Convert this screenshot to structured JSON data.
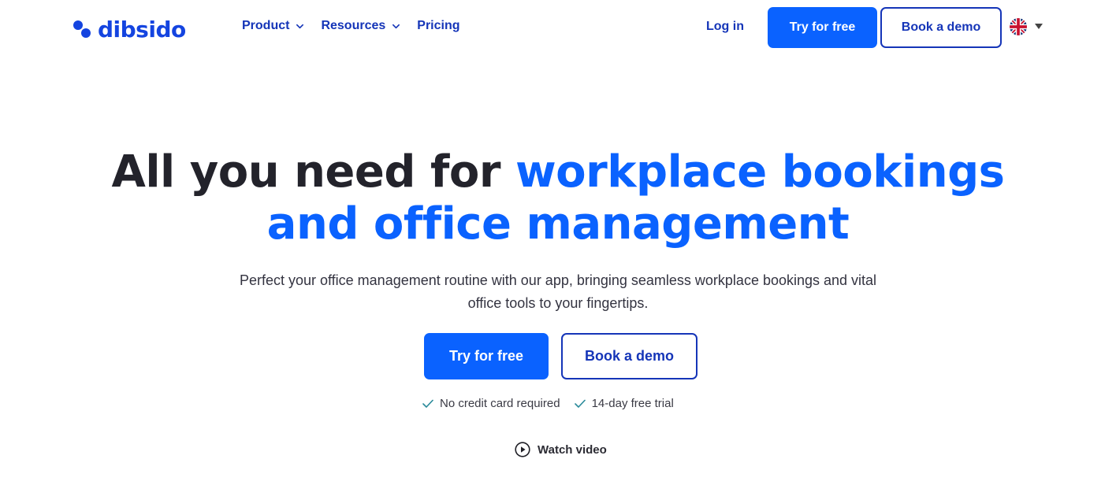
{
  "header": {
    "logo_text": "dibsido",
    "nav": [
      {
        "label": "Product",
        "has_dropdown": true,
        "icon": "chevron-down-icon"
      },
      {
        "label": "Resources",
        "has_dropdown": true,
        "icon": "chevron-down-icon"
      },
      {
        "label": "Pricing",
        "has_dropdown": false
      }
    ],
    "login_label": "Log in",
    "try_label": "Try for free",
    "demo_label": "Book a demo",
    "language_icon": "uk-flag-icon",
    "language_caret_icon": "caret-down-icon"
  },
  "hero": {
    "title_plain": "All you need for ",
    "title_accent_line1": "workplace bookings",
    "title_accent_line2": "and office management",
    "subtitle_line1": "Perfect your office management routine with our app, bringing seamless workplace bookings and vital",
    "subtitle_line2": "office tools to your fingertips.",
    "try_label": "Try for free",
    "demo_label": "Book a demo",
    "notes": [
      {
        "label": "No credit card required",
        "icon": "check-icon"
      },
      {
        "label": "14-day free trial",
        "icon": "check-icon"
      }
    ],
    "watch_label": "Watch video",
    "watch_icon": "play-circle-icon"
  },
  "colors": {
    "brand_blue": "#0a62ff",
    "nav_blue": "#1535b8",
    "logo_blue": "#1444e0",
    "title_dark": "#23232b",
    "check_teal": "#2a8a9a"
  }
}
